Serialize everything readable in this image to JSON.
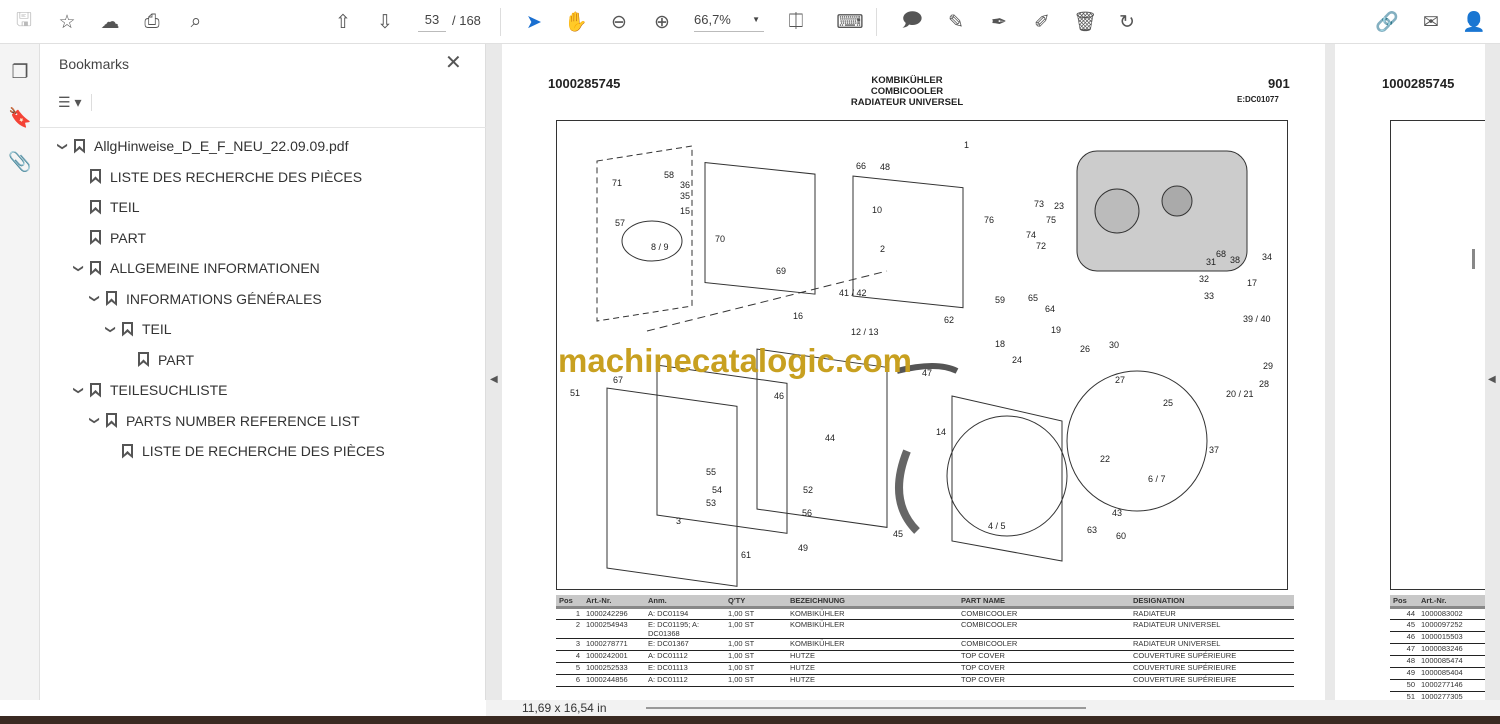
{
  "toolbar": {
    "page_current": "53",
    "page_total": "/ 168",
    "zoom": "66,7%"
  },
  "sidebar": {
    "title": "Bookmarks",
    "items": [
      {
        "label": "AllgHinweise_D_E_F_NEU_22.09.09.pdf",
        "level": 0,
        "expanded": true
      },
      {
        "label": "LISTE DES RECHERCHE DES PIÈCES",
        "level": 1
      },
      {
        "label": "TEIL",
        "level": 1
      },
      {
        "label": "PART",
        "level": 1
      },
      {
        "label": "ALLGEMEINE INFORMATIONEN",
        "level": 1,
        "expanded": true
      },
      {
        "label": "INFORMATIONS GÉNÉRALES",
        "level": 2,
        "expanded": true
      },
      {
        "label": "TEIL",
        "level": 3,
        "expanded": true
      },
      {
        "label": "PART",
        "level": 4
      },
      {
        "label": "TEILESUCHLISTE",
        "level": 1,
        "expanded": true
      },
      {
        "label": "PARTS NUMBER REFERENCE LIST",
        "level": 2,
        "expanded": true
      },
      {
        "label": "LISTE DE RECHERCHE DES PIÈCES",
        "level": 3
      }
    ]
  },
  "page1": {
    "part_no": "1000285745",
    "title_de": "KOMBIKÜHLER",
    "title_en": "COMBICOOLER",
    "title_fr": "RADIATEUR UNIVERSEL",
    "page_code": "901",
    "ref": "E:DC01077",
    "watermark": "machinecatalogic.com",
    "callouts": [
      "1",
      "2",
      "3",
      "4 / 5",
      "6 / 7",
      "8 / 9",
      "10",
      "12 / 13",
      "14",
      "15",
      "16",
      "17",
      "18",
      "19",
      "20 / 21",
      "22",
      "23",
      "24",
      "25",
      "26",
      "27",
      "28",
      "29",
      "30",
      "31",
      "32",
      "33",
      "34",
      "35",
      "36",
      "37",
      "38",
      "39 / 40",
      "41 / 42",
      "43",
      "44",
      "45",
      "46",
      "47",
      "48",
      "49",
      "51",
      "52",
      "53",
      "54",
      "55",
      "56",
      "57",
      "58",
      "59",
      "60",
      "61",
      "62",
      "63",
      "64",
      "65",
      "66",
      "67",
      "68",
      "69",
      "70",
      "71",
      "72",
      "73",
      "74",
      "75",
      "76"
    ],
    "table_headers": [
      "Pos",
      "Art.-Nr.",
      "Anm.",
      "Q'TY",
      "BEZEICHNUNG",
      "PART NAME",
      "DESIGNATION"
    ],
    "rows": [
      [
        "1",
        "1000242296",
        "A: DC01194",
        "1,00 ST",
        "KOMBIKÜHLER",
        "COMBICOOLER",
        "RADIATEUR"
      ],
      [
        "2",
        "1000254943",
        "E: DC01195; A: DC01368",
        "1,00 ST",
        "KOMBIKÜHLER",
        "COMBICOOLER",
        "RADIATEUR UNIVERSEL"
      ],
      [
        "3",
        "1000278771",
        "E: DC01367",
        "1,00 ST",
        "KOMBIKÜHLER",
        "COMBICOOLER",
        "RADIATEUR UNIVERSEL"
      ],
      [
        "4",
        "1000242001",
        "A: DC01112",
        "1,00 ST",
        "HUTZE",
        "TOP COVER",
        "COUVERTURE SUPÉRIEURE"
      ],
      [
        "5",
        "1000252533",
        "E: DC01113",
        "1,00 ST",
        "HUTZE",
        "TOP COVER",
        "COUVERTURE SUPÉRIEURE"
      ],
      [
        "6",
        "1000244856",
        "A: DC01112",
        "1,00 ST",
        "HUTZE",
        "TOP COVER",
        "COUVERTURE SUPÉRIEURE"
      ]
    ]
  },
  "page2": {
    "part_no": "1000285745",
    "table_headers": [
      "Pos",
      "Art.-Nr."
    ],
    "rows": [
      [
        "44",
        "1000083002"
      ],
      [
        "45",
        "1000097252"
      ],
      [
        "46",
        "1000015503"
      ],
      [
        "47",
        "1000083246"
      ],
      [
        "48",
        "1000085474"
      ],
      [
        "49",
        "1000085404"
      ],
      [
        "50",
        "1000277146"
      ],
      [
        "51",
        "1000277305"
      ]
    ]
  },
  "status": {
    "page_size": "11,69 x 16,54 in"
  }
}
